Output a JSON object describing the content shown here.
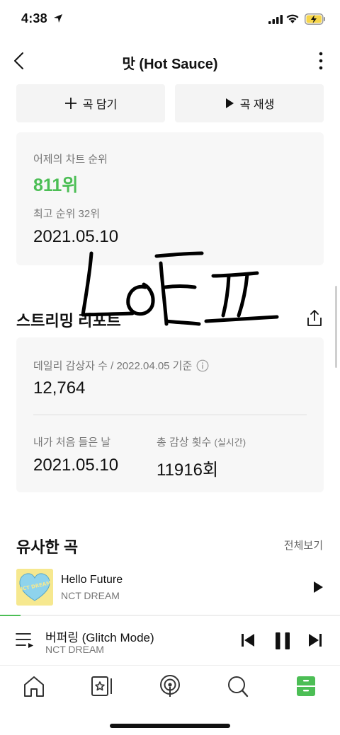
{
  "status": {
    "time": "4:38"
  },
  "nav": {
    "title": "맛 (Hot Sauce)"
  },
  "actions": {
    "add_label": "곡 담기",
    "play_label": "곡 재생"
  },
  "chart": {
    "label": "어제의 차트 순위",
    "rank": "811위",
    "best_rank": "최고 순위 32위",
    "best_date": "2021.05.10"
  },
  "report": {
    "title": "스트리밍 리포트",
    "daily_label": "데일리 감상자 수 / 2022.04.05 기준",
    "daily_value": "12,764",
    "first_listen_label": "내가 처음 들은 날",
    "first_listen_date": "2021.05.10",
    "total_label": "총 감상 횟수",
    "total_sub": "(실시간)",
    "total_value": "11916회"
  },
  "similar": {
    "title": "유사한 곡",
    "view_all": "전체보기",
    "songs": [
      {
        "title": "Hello Future",
        "artist": "NCT DREAM",
        "art_text": "NCT DREAM",
        "art_color": "#f6e88f"
      }
    ]
  },
  "player": {
    "title": "버퍼링 (Glitch Mode)",
    "artist": "NCT DREAM",
    "progress": 0.06
  },
  "colors": {
    "accent": "#4cbe55",
    "card": "#f7f7f7",
    "button": "#f4f4f4"
  },
  "tabs": [
    {
      "icon": "home-icon"
    },
    {
      "icon": "library-icon"
    },
    {
      "icon": "podcast-icon"
    },
    {
      "icon": "search-icon"
    },
    {
      "icon": "storage-icon",
      "active": true
    }
  ]
}
